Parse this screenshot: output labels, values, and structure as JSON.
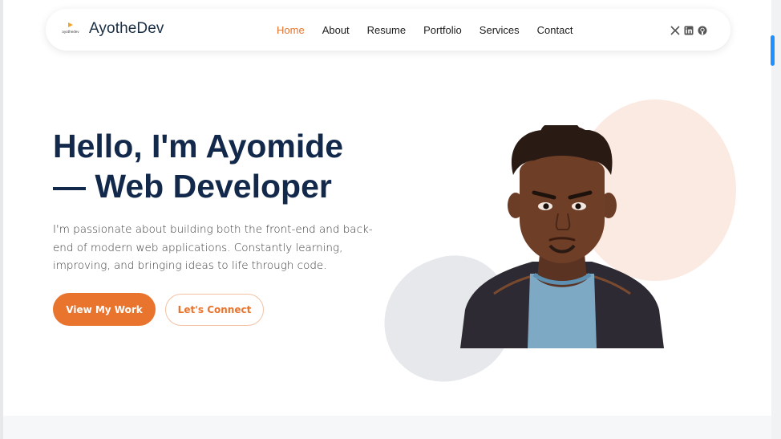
{
  "brand": {
    "logo_text": "ayothedev",
    "name": "AyotheDev"
  },
  "nav": [
    {
      "label": "Home",
      "active": true
    },
    {
      "label": "About",
      "active": false
    },
    {
      "label": "Resume",
      "active": false
    },
    {
      "label": "Portfolio",
      "active": false
    },
    {
      "label": "Services",
      "active": false
    },
    {
      "label": "Contact",
      "active": false
    }
  ],
  "socials": [
    "x-icon",
    "linkedin-icon",
    "github-icon"
  ],
  "hero": {
    "title_line1": "Hello, I'm Ayomide",
    "title_line2": "— Web Developer",
    "description": "I'm passionate about building both the front-end and back-end of modern web applications. Constantly learning, improving, and bringing ideas to life through code.",
    "primary_button": "View My Work",
    "secondary_button": "Let's Connect"
  },
  "colors": {
    "accent": "#e8742e",
    "heading": "#13294b",
    "peach": "#fbeae1",
    "gray_blob": "#e6e8ec"
  }
}
